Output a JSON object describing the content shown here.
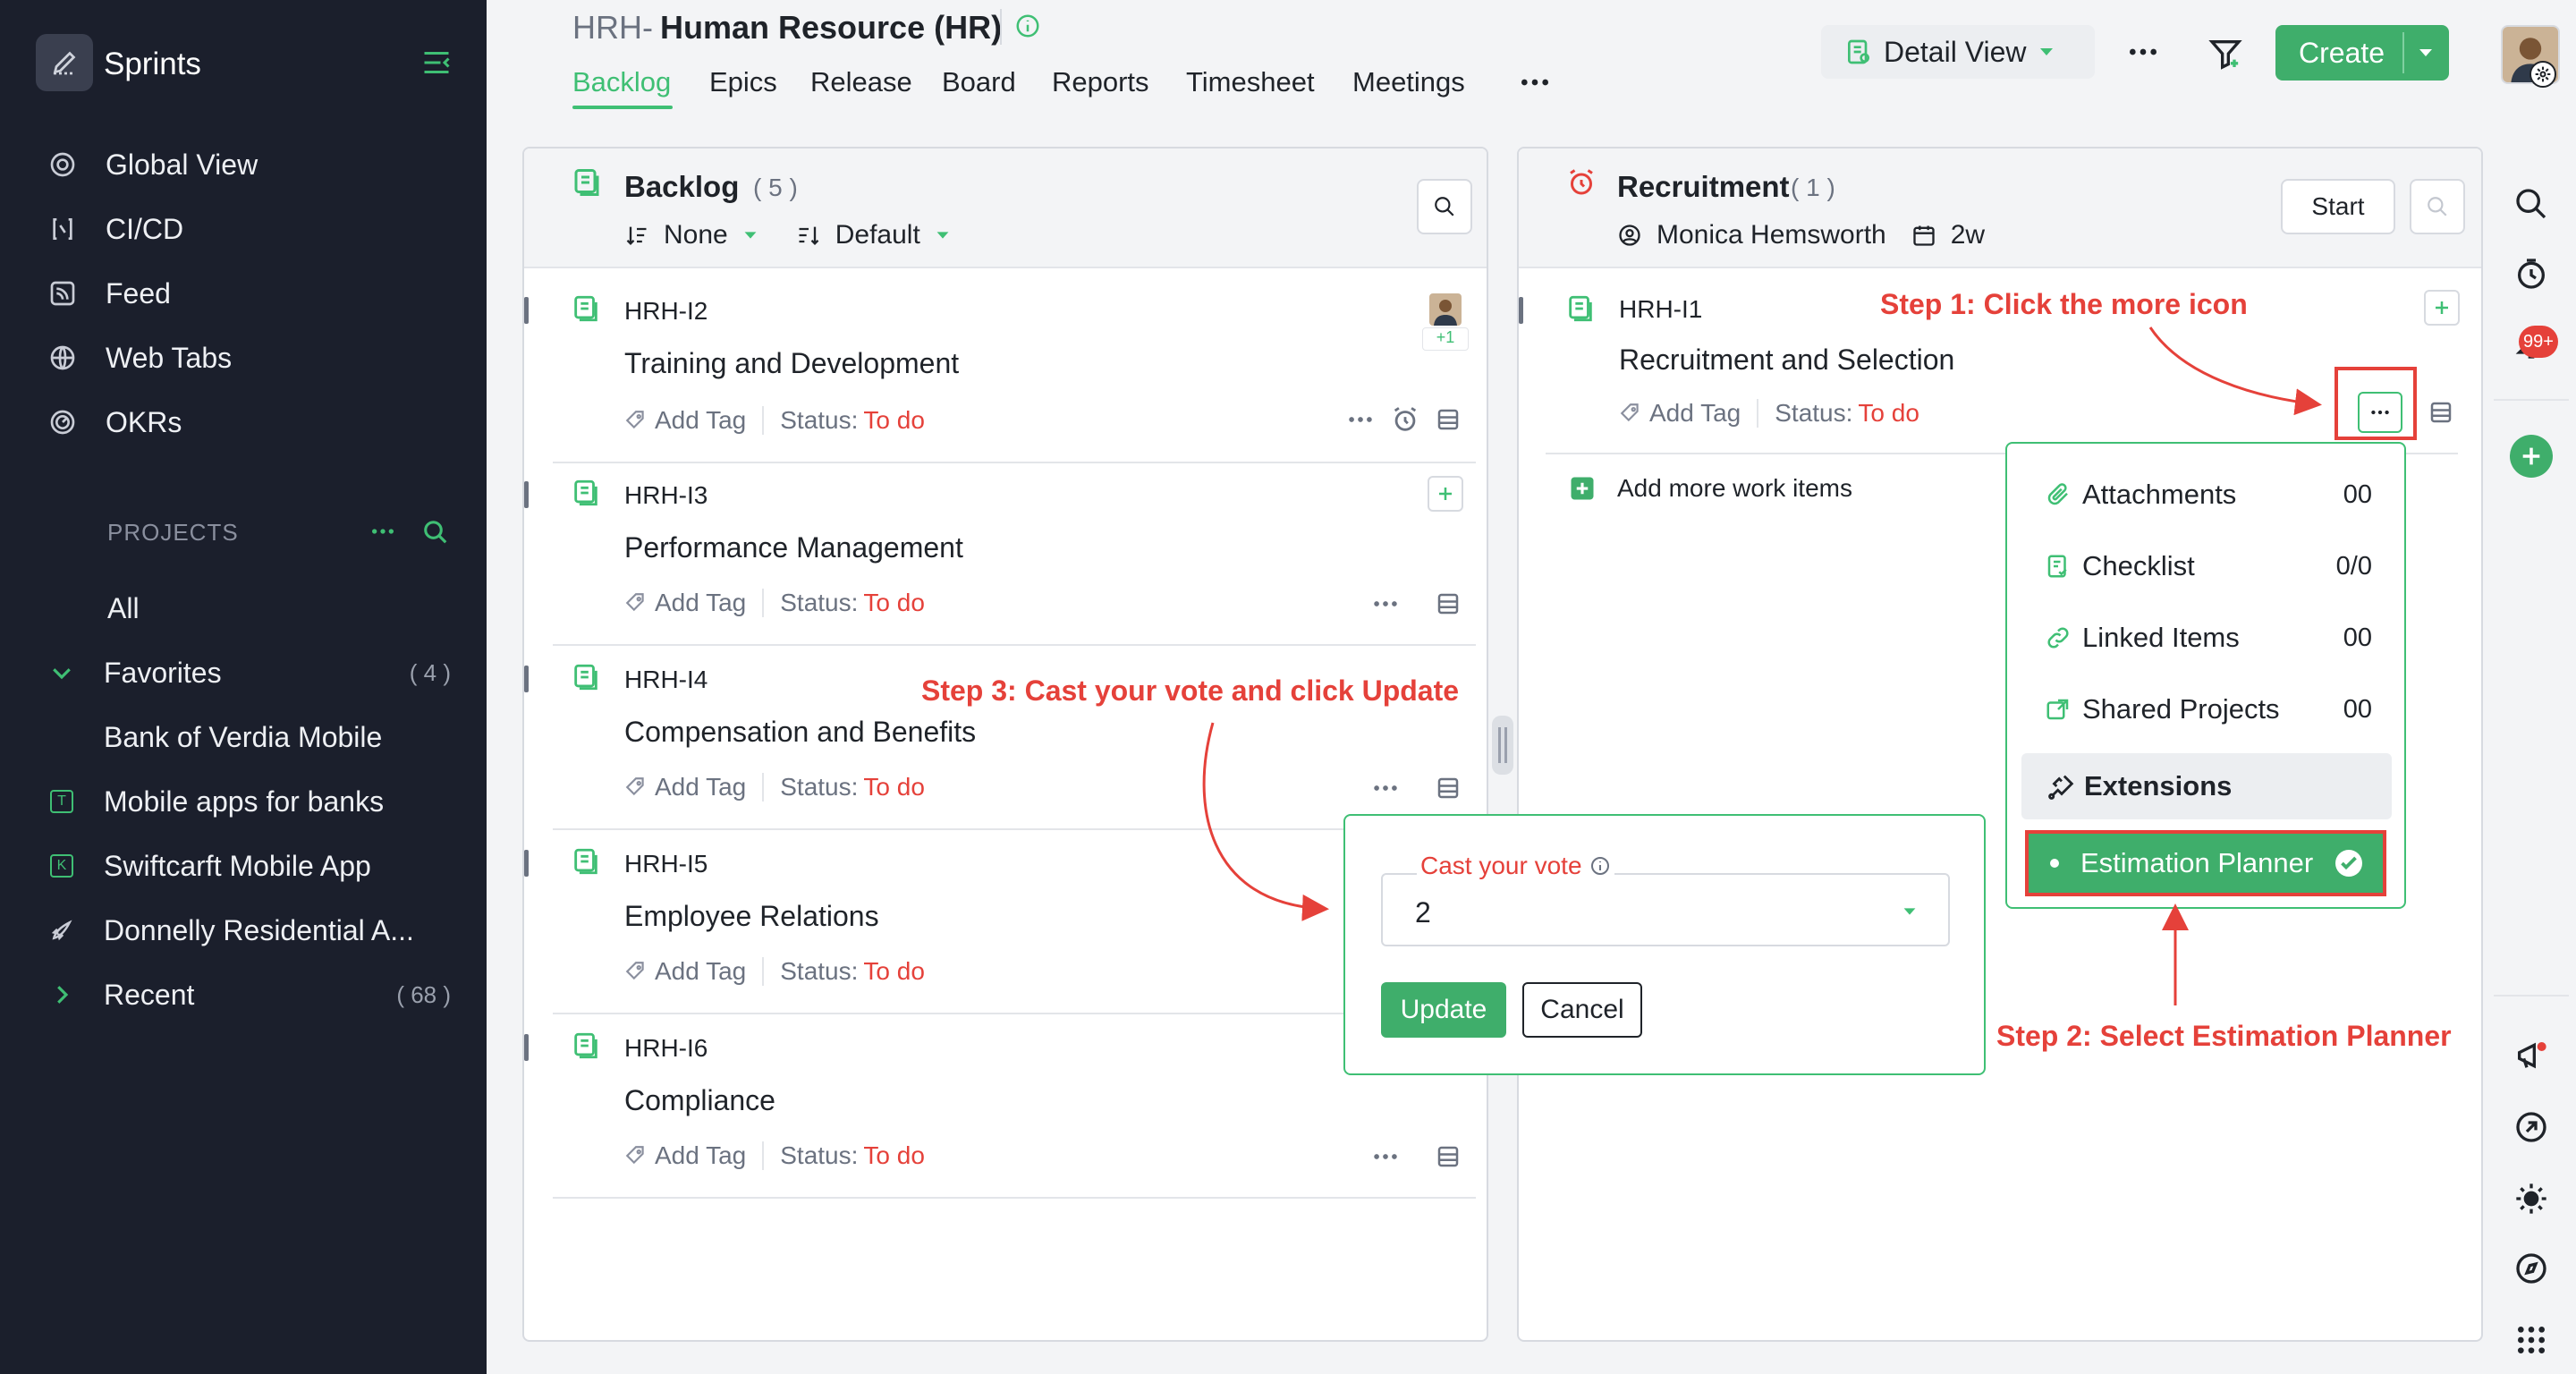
{
  "sidebar": {
    "brand": "Sprints",
    "nav": [
      {
        "label": "Global View",
        "icon": "global-view-icon"
      },
      {
        "label": "CI/CD",
        "icon": "cicd-icon"
      },
      {
        "label": "Feed",
        "icon": "feed-icon"
      },
      {
        "label": "Web Tabs",
        "icon": "web-tabs-icon"
      },
      {
        "label": "OKRs",
        "icon": "okrs-icon"
      }
    ],
    "projects_heading": "PROJECTS",
    "all_label": "All",
    "favorites": {
      "label": "Favorites",
      "count": "( 4 )"
    },
    "favorite_projects": [
      {
        "label": "Bank of Verdia Mobile"
      },
      {
        "label": "Mobile apps for banks",
        "badge": "T"
      },
      {
        "label": "Swiftcarft Mobile App",
        "badge": "K"
      },
      {
        "label": "Donnelly Residential A..."
      }
    ],
    "recent": {
      "label": "Recent",
      "count": "( 68 )"
    }
  },
  "header": {
    "prefix": "HRH-",
    "title": "Human Resource (HR)",
    "tabs": [
      "Backlog",
      "Epics",
      "Release",
      "Board",
      "Reports",
      "Timesheet",
      "Meetings"
    ],
    "active_tab": "Backlog",
    "view_label": "Detail View",
    "create_label": "Create"
  },
  "backlog": {
    "title": "Backlog",
    "count": "( 5 )",
    "sort_label": "None",
    "group_label": "Default",
    "items": [
      {
        "id": "HRH-I2",
        "name": "Training and Development",
        "tag": "Add Tag",
        "status_label": "Status:",
        "status": "To do",
        "assignee_more": "+1"
      },
      {
        "id": "HRH-I3",
        "name": "Performance Management",
        "tag": "Add Tag",
        "status_label": "Status:",
        "status": "To do"
      },
      {
        "id": "HRH-I4",
        "name": "Compensation and Benefits",
        "tag": "Add Tag",
        "status_label": "Status:",
        "status": "To do"
      },
      {
        "id": "HRH-I5",
        "name": "Employee Relations",
        "tag": "Add Tag",
        "status_label": "Status:",
        "status": "To do"
      },
      {
        "id": "HRH-I6",
        "name": "Compliance",
        "tag": "Add Tag",
        "status_label": "Status:",
        "status": "To do"
      }
    ]
  },
  "sprint": {
    "title": "Recruitment",
    "count": "( 1 )",
    "owner": "Monica Hemsworth",
    "duration": "2w",
    "start_label": "Start",
    "items": [
      {
        "id": "HRH-I1",
        "name": "Recruitment and Selection",
        "tag": "Add Tag",
        "status_label": "Status:",
        "status": "To do"
      }
    ],
    "add_more": "Add more work items"
  },
  "menu": {
    "items": [
      {
        "label": "Attachments",
        "value": "00",
        "icon": "paperclip-icon"
      },
      {
        "label": "Checklist",
        "value": "0/0",
        "icon": "checklist-icon"
      },
      {
        "label": "Linked Items",
        "value": "00",
        "icon": "link-icon"
      },
      {
        "label": "Shared Projects",
        "value": "00",
        "icon": "share-icon"
      }
    ],
    "extensions_label": "Extensions",
    "estimation_label": "Estimation Planner"
  },
  "vote": {
    "label": "Cast your vote",
    "value": "2",
    "update_label": "Update",
    "cancel_label": "Cancel"
  },
  "annotations": {
    "step1": "Step 1: Click the more icon",
    "step2": "Step 2: Select Estimation Planner",
    "step3": "Step 3: Cast your vote and click Update"
  },
  "rail": {
    "notification_badge": "99+"
  },
  "colors": {
    "accent": "#3fbf74",
    "button": "#3fae6b",
    "status_todo": "#e5413a",
    "sidebar_bg": "#1b1f2c",
    "annotation": "#e5413a"
  }
}
